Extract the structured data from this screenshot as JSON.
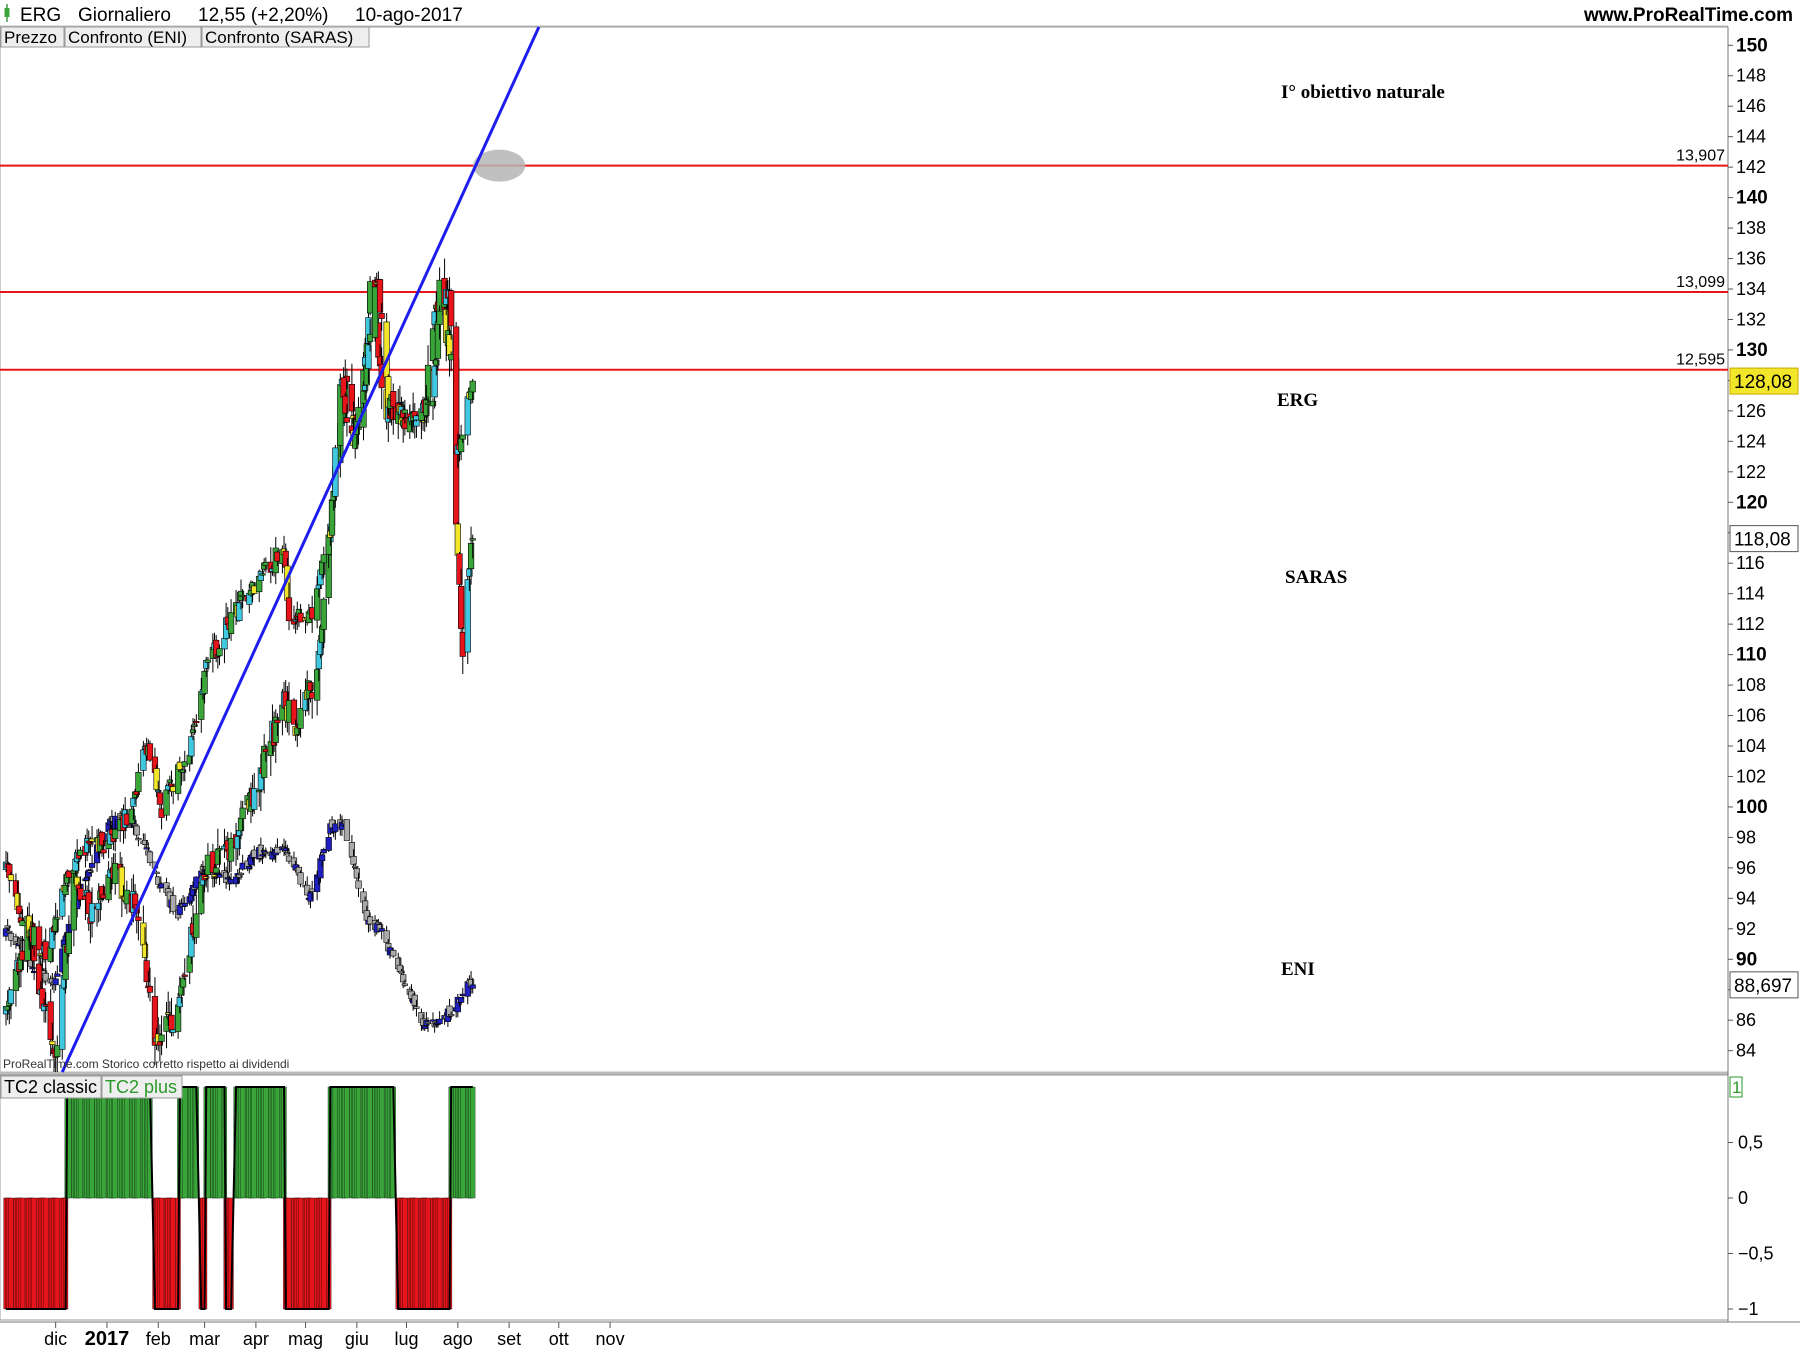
{
  "header": {
    "symbol": "ERG",
    "timeframe": "Giornaliero",
    "price_change": "12,55 (+2,20%)",
    "date": "10-ago-2017",
    "site": "www.ProRealTime.com"
  },
  "tabs": [
    "Prezzo",
    "Confronto (ENI)",
    "Confronto (SARAS)"
  ],
  "indicator_tabs": [
    "TC2 classic",
    "TC2 plus"
  ],
  "footer_note": "ProRealTime.com  Storico corretto rispetto ai dividendi",
  "colors": {
    "background": "#ffffff",
    "trendline": "#1d1df0",
    "resistance": "#e8141b",
    "bull_green": "#3aa63a",
    "bear_red": "#e8141b",
    "cyan": "#40c8e0",
    "yellow": "#f2e62a",
    "eni_gray": "#aaaaaa",
    "eni_blue": "#2020c0",
    "histogram_green": "#3aa63a",
    "histogram_red": "#e8141b"
  },
  "chart_data": {
    "type": "candlestick",
    "price_axis": {
      "range": [
        82.6,
        151.2
      ],
      "ticks": [
        84,
        86,
        88,
        90,
        92,
        94,
        96,
        98,
        100,
        102,
        104,
        106,
        108,
        110,
        112,
        114,
        116,
        118,
        120,
        122,
        124,
        126,
        128,
        130,
        132,
        134,
        136,
        138,
        140,
        142,
        144,
        146,
        148,
        150
      ],
      "bold_ticks": [
        90,
        100,
        110,
        120,
        130,
        140,
        150
      ]
    },
    "x_axis": {
      "labels": [
        "dic",
        "2017",
        "feb",
        "mar",
        "apr",
        "mag",
        "giu",
        "lug",
        "ago",
        "set",
        "ott",
        "nov"
      ]
    },
    "series": [
      {
        "name": "ERG",
        "start": "2016-11-01",
        "end": "2017-08-10",
        "approx_start": 97,
        "last": 128.08,
        "high": 138.4
      },
      {
        "name": "SARAS",
        "start": "2016-11-01",
        "end": "2017-08-10",
        "approx_start": 86,
        "last": 118.08,
        "high": 137.2,
        "low": 108.6
      },
      {
        "name": "ENI",
        "start": "2016-11-01",
        "end": "2017-08-10",
        "approx_start": 92,
        "last": 88.697,
        "high": 99.6,
        "low": 85.4
      }
    ],
    "price_labels": [
      "128,08",
      "118,08",
      "88,697"
    ],
    "horizontal_levels": [
      {
        "label": "13,907",
        "value": 142.1
      },
      {
        "label": "13,099",
        "value": 133.8
      },
      {
        "label": "12,595",
        "value": 128.7
      }
    ],
    "trendline": {
      "from": {
        "date": "2016-12-05",
        "value": 82.6
      },
      "to": {
        "date": "2017-09-19",
        "value": 151.2
      }
    },
    "highlight_ellipse": {
      "date": "2017-08-26",
      "value": 142.1
    },
    "annotations": [
      "I° obiettivo naturale",
      "ERG",
      "SARAS",
      "ENI"
    ],
    "indicator": {
      "name": "TC2 classic",
      "axis_ticks": [
        1,
        0.5,
        0,
        -0.5,
        -1
      ],
      "axis_labels": [
        "0,5",
        "0",
        "−0,5",
        "−1"
      ],
      "last_value_label": "1",
      "regimes": [
        {
          "value": -1,
          "from": "2016-11-01",
          "to": "2016-12-07"
        },
        {
          "value": 1,
          "from": "2016-12-08",
          "to": "2017-01-27"
        },
        {
          "value": -1,
          "from": "2017-01-30",
          "to": "2017-02-13"
        },
        {
          "value": 1,
          "from": "2017-02-14",
          "to": "2017-02-24"
        },
        {
          "value": -1,
          "from": "2017-02-27",
          "to": "2017-03-01"
        },
        {
          "value": 1,
          "from": "2017-03-02",
          "to": "2017-03-13"
        },
        {
          "value": -1,
          "from": "2017-03-14",
          "to": "2017-03-17"
        },
        {
          "value": 1,
          "from": "2017-03-20",
          "to": "2017-04-18"
        },
        {
          "value": -1,
          "from": "2017-04-19",
          "to": "2017-05-15"
        },
        {
          "value": 1,
          "from": "2017-05-16",
          "to": "2017-06-23"
        },
        {
          "value": -1,
          "from": "2017-06-26",
          "to": "2017-07-27"
        },
        {
          "value": 1,
          "from": "2017-07-28",
          "to": "2017-08-10"
        }
      ]
    }
  }
}
